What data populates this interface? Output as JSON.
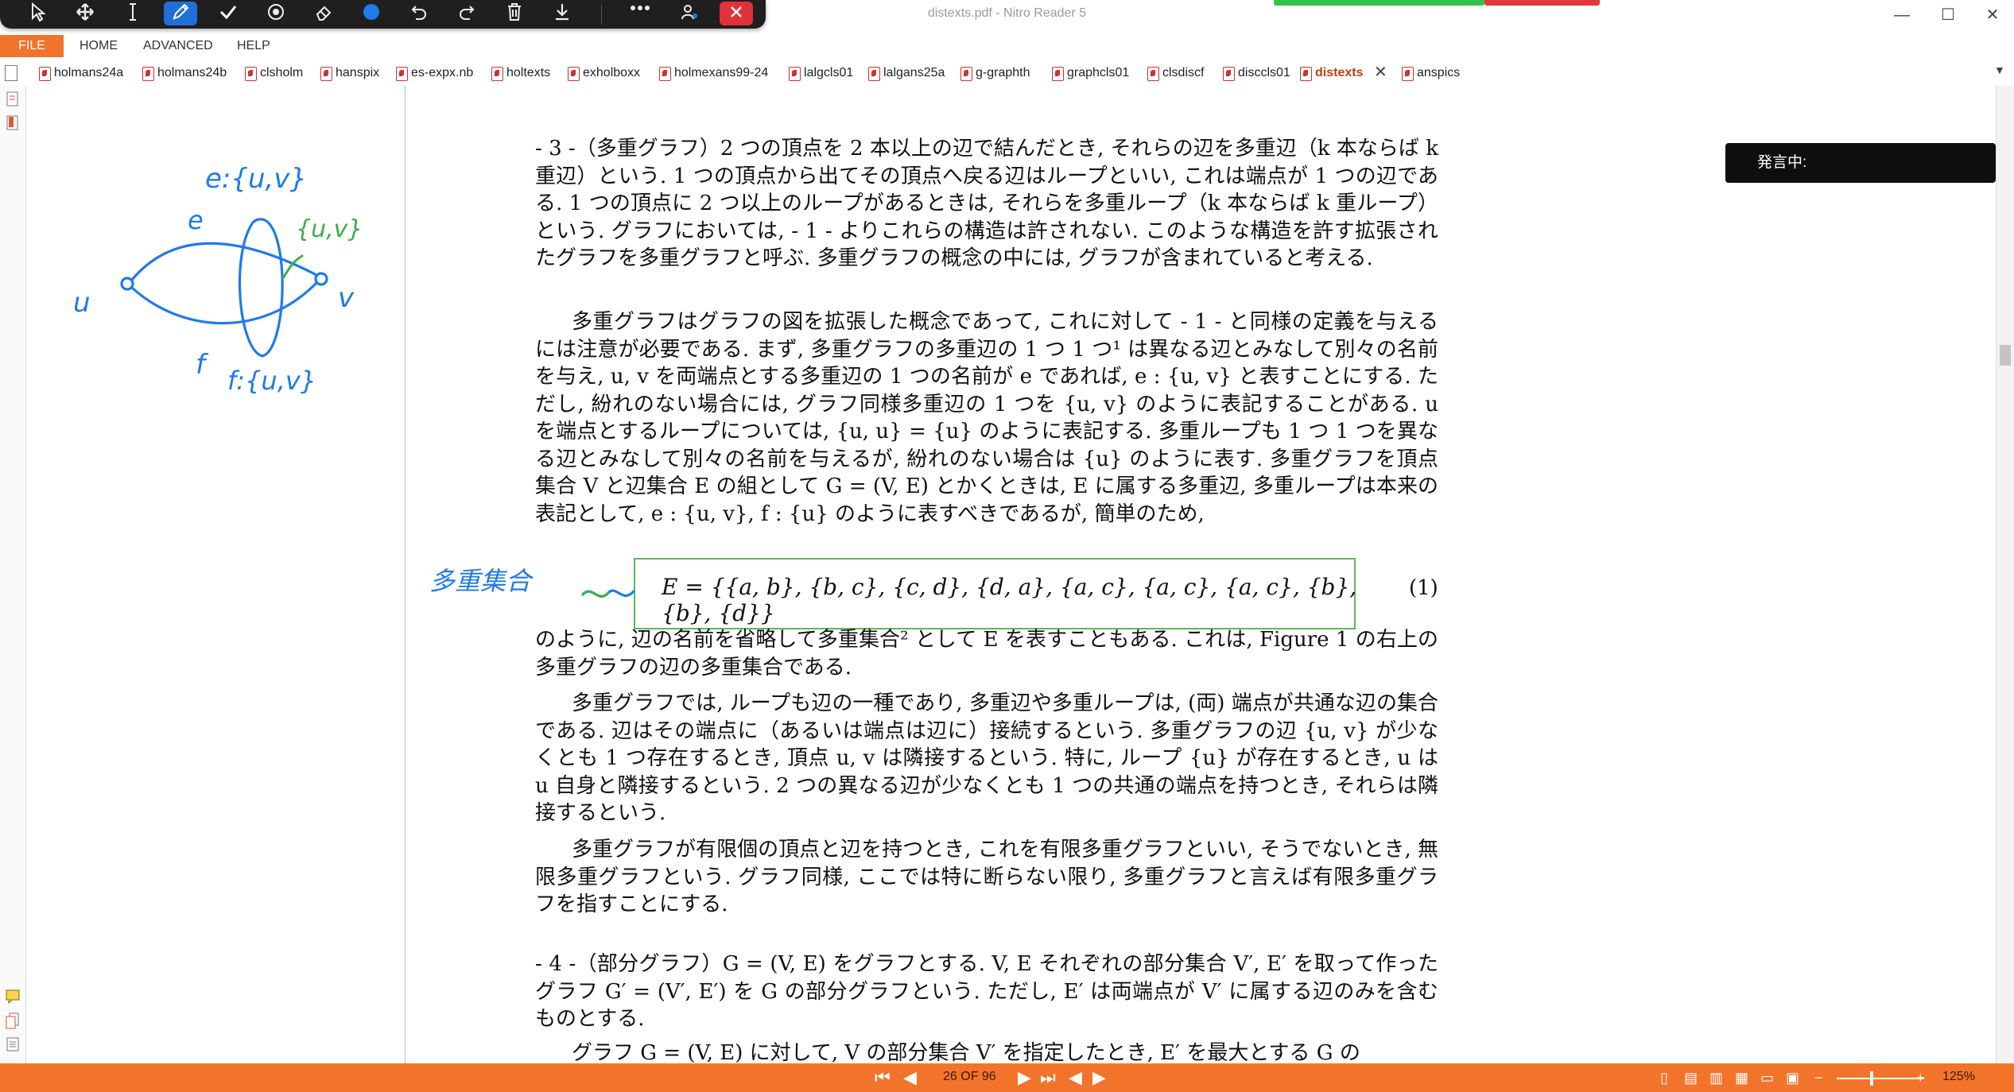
{
  "window": {
    "title": "distexts.pdf - Nitro Reader 5",
    "controls": {
      "minimize": "—",
      "maximize": "☐",
      "close": "✕"
    }
  },
  "ink_toolbar": {
    "tools": [
      "select-arrow",
      "pan-move",
      "text-cursor",
      "pen",
      "checkmark",
      "stamp-target",
      "eraser",
      "color-blue",
      "undo",
      "redo",
      "delete",
      "save-download",
      "more",
      "account",
      "close"
    ],
    "active_tool": "pen",
    "color": "#1e7bea"
  },
  "menu": {
    "items": [
      "FILE",
      "HOME",
      "ADVANCED",
      "HELP"
    ]
  },
  "tabs": [
    "holmans24a",
    "holmans24b",
    "clsholm",
    "hanspix",
    "es-expx.nb",
    "holtexts",
    "exholboxx",
    "holmexans99-24",
    "lalgcls01",
    "lalgans25a",
    "g-graphth",
    "graphcls01",
    "clsdiscf",
    "disccls01",
    "distexts",
    "anspics"
  ],
  "active_tab": "distexts",
  "document": {
    "para1": "- 3 -（多重グラフ）2 つの頂点を 2 本以上の辺で結んだとき, それらの辺を多重辺（k 本ならば k 重辺）という. 1 つの頂点から出てその頂点へ戻る辺はループといい, これは端点が 1 つの辺である. 1 つの頂点に 2 つ以上のループがあるときは, それらを多重ループ（k 本ならば k 重ループ）という. グラフにおいては, - 1 - よりこれらの構造は許されない. このような構造を許す拡張されたグラフを多重グラフと呼ぶ. 多重グラフの概念の中には, グラフが含まれていると考える.",
    "para2": "多重グラフはグラフの図を拡張した概念であって, これに対して - 1 - と同様の定義を与えるには注意が必要である. まず, 多重グラフの多重辺の 1 つ 1 つ¹ は異なる辺とみなして別々の名前を与え, u, v を両端点とする多重辺の 1 つの名前が e であれば, e : {u, v} と表すことにする. ただし, 紛れのない場合には, グラフ同様多重辺の 1 つを {u, v} のように表記することがある. u を端点とするループについては, {u, u} = {u} のように表記する. 多重ループも 1 つ 1 つを異なる辺とみなして別々の名前を与えるが, 紛れのない場合は {u} のように表す. 多重グラフを頂点集合 V と辺集合 E の組として G = (V, E) とかくときは, E に属する多重辺, 多重ループは本来の表記として, e : {u, v}, f : {u} のように表すべきであるが, 簡単のため,",
    "equation": "E = {{a, b}, {b, c}, {c, d}, {d, a}, {a, c}, {a, c}, {a, c}, {b}, {b}, {d}}",
    "equation_number": "(1)",
    "para3": "のように, 辺の名前を省略して多重集合² として E を表すこともある. これは, Figure 1 の右上の多重グラフの辺の多重集合である.",
    "para4": "多重グラフでは, ループも辺の一種であり, 多重辺や多重ループは, (両) 端点が共通な辺の集合である. 辺はその端点に（あるいは端点は辺に）接続するという. 多重グラフの辺 {u, v} が少なくとも 1 つ存在するとき, 頂点 u, v は隣接するという. 特に, ループ {u} が存在するとき, u は u 自身と隣接するという. 2 つの異なる辺が少なくとも 1 つの共通の端点を持つとき, それらは隣接するという.",
    "para5": "多重グラフが有限個の頂点と辺を持つとき, これを有限多重グラフといい, そうでないとき, 無限多重グラフという. グラフ同様, ここでは特に断らない限り, 多重グラフと言えば有限多重グラフを指すことにする.",
    "para6": "- 4 -（部分グラフ）G = (V, E) をグラフとする. V, E それぞれの部分集合 V′, E′ を取って作ったグラフ G′ = (V′, E′) を G の部分グラフという. ただし, E′ は両端点が V′ に属する辺のみを含むものとする.",
    "para7": "グラフ G = (V, E) に対して, V の部分集合 V′ を指定したとき, E′ を最大とする G の"
  },
  "handwriting": {
    "e_label": "e:{u,v}",
    "uv_label": "{u,v}",
    "e": "e",
    "f": "f",
    "u": "u",
    "v": "v",
    "f_label": "f:{u,v}",
    "multiset_note": "多重集合"
  },
  "speaking_overlay": "発言中:",
  "status": {
    "page_indicator": "26 OF 96",
    "zoom": "125%"
  },
  "colors": {
    "accent": "#f2742a",
    "ink_blue": "#1e7bea",
    "ink_green": "#3fae4a",
    "eq_box": "#5cb85c"
  }
}
